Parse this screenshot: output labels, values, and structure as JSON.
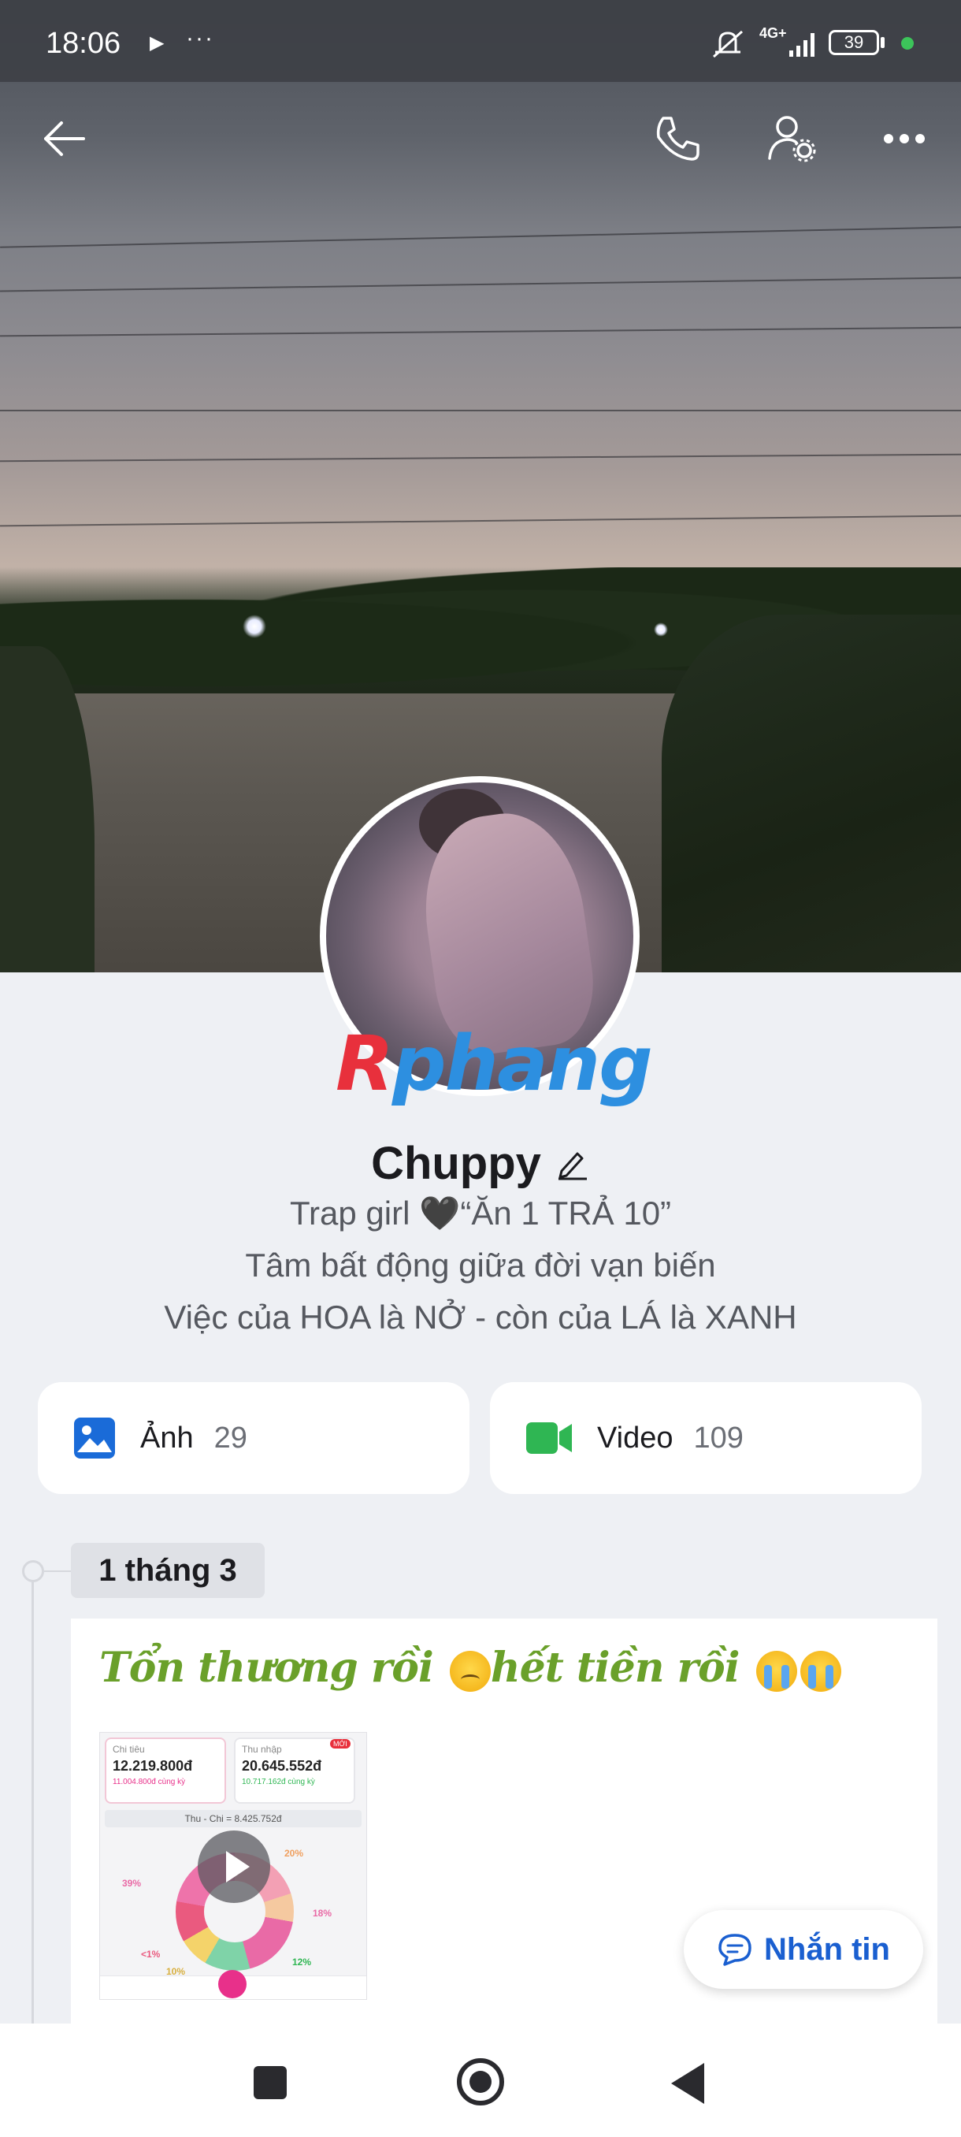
{
  "status_bar": {
    "time": "18:06",
    "play_glyph": "▶",
    "more_glyph": "···",
    "network": "4G+",
    "battery": "39",
    "icons": [
      "play-icon",
      "more-dots-icon",
      "mute-icon",
      "signal-icon",
      "battery-icon",
      "active-dot-icon"
    ]
  },
  "header_actions": {
    "icons": [
      "back-arrow-icon",
      "phone-icon",
      "user-settings-icon",
      "more-horizontal-icon"
    ]
  },
  "profile": {
    "name": "Chuppy",
    "bio_lines": [
      "Trap girl 🖤“Ăn 1 TRẢ 10”",
      "Tâm bất động giữa đời vạn biến",
      "Việc của HOA là NỞ - còn của LÁ là XANH"
    ],
    "watermark": {
      "first": "R",
      "rest": "phang",
      "colors": [
        "#e8303c",
        "#2d8fe0"
      ]
    }
  },
  "media": {
    "photos": {
      "label": "Ảnh",
      "count": "29",
      "icon": "image-icon",
      "color": "#1a6bd8"
    },
    "videos": {
      "label": "Video",
      "count": "109",
      "icon": "video-camera-icon",
      "color": "#2fb653"
    }
  },
  "timeline": {
    "date": "1 tháng 3",
    "post": {
      "text": "Tổn thương rồi",
      "text2": "hết tiền rồi",
      "text_color": "#6aa02a",
      "thumbnail": {
        "spend_label": "Chi tiêu",
        "spend_value": "12.219.800đ",
        "spend_prev": "11.004.800đ cùng kỳ",
        "income_label": "Thu nhập",
        "income_value": "20.645.552đ",
        "income_prev": "10.717.162đ cùng kỳ",
        "badge": "MỚI",
        "net": "Thu - Chi = 8.425.752đ",
        "pct": [
          "20%",
          "39%",
          "18%",
          "<1%",
          "12%",
          "10%"
        ]
      }
    }
  },
  "message_button": {
    "label": "Nhắn tin",
    "icon": "chat-bubble-icon"
  },
  "bottom_nav": {
    "icons": [
      "recents-square-icon",
      "home-circle-icon",
      "back-triangle-icon"
    ]
  }
}
